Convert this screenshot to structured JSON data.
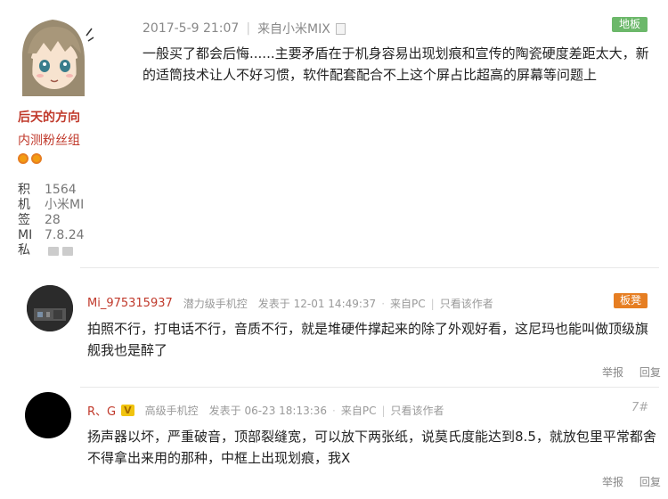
{
  "post": {
    "username": "后天的方向",
    "group": "内测粉丝组",
    "stats": [
      {
        "key": "积",
        "value": "1564"
      },
      {
        "key": "机",
        "value": "小米MI"
      },
      {
        "key": "签",
        "value": "28"
      },
      {
        "key": "MI",
        "value": "7.8.24"
      },
      {
        "key": "私",
        "value": ""
      }
    ],
    "datetime": "2017-5-9 21:07",
    "source": "来自小米MIX",
    "floor_badge": "地板",
    "content": "一般买了都会后悔......主要矛盾在于机身容易出现划痕和宣传的陶瓷硬度差距太大，新的适筒技术让人不好习惯，软件配套配合不上这个屏占比超高的屏幕等问题上"
  },
  "replies": [
    {
      "username": "Mi_975315937",
      "level": "潜力级手机控",
      "time": "发表于 12-01 14:49:37",
      "source": "来自PC",
      "author_only": "只看该作者",
      "badge": "板凳",
      "content": "拍照不行，打电话不行，音质不行，就是堆硬件撑起来的除了外观好看，这尼玛也能叫做顶级旗舰我也是醉了",
      "report": "举报",
      "reply": "回复"
    },
    {
      "username": "R、G",
      "v_badge": "V",
      "level": "高级手机控",
      "time": "发表于 06-23 18:13:36",
      "source": "来自PC",
      "author_only": "只看该作者",
      "floor": "7#",
      "content": "扬声器以坏，严重破音，顶部裂缝宽，可以放下两张纸，说莫氏度能达到8.5，就放包里平常都舍不得拿出来用的那种，中框上出现划痕，我X",
      "report": "举报",
      "reply": "回复"
    }
  ],
  "colors": {
    "username": "#c0392b",
    "floor_badge_green": "#6cb86a",
    "badge_orange": "#e67e22"
  }
}
